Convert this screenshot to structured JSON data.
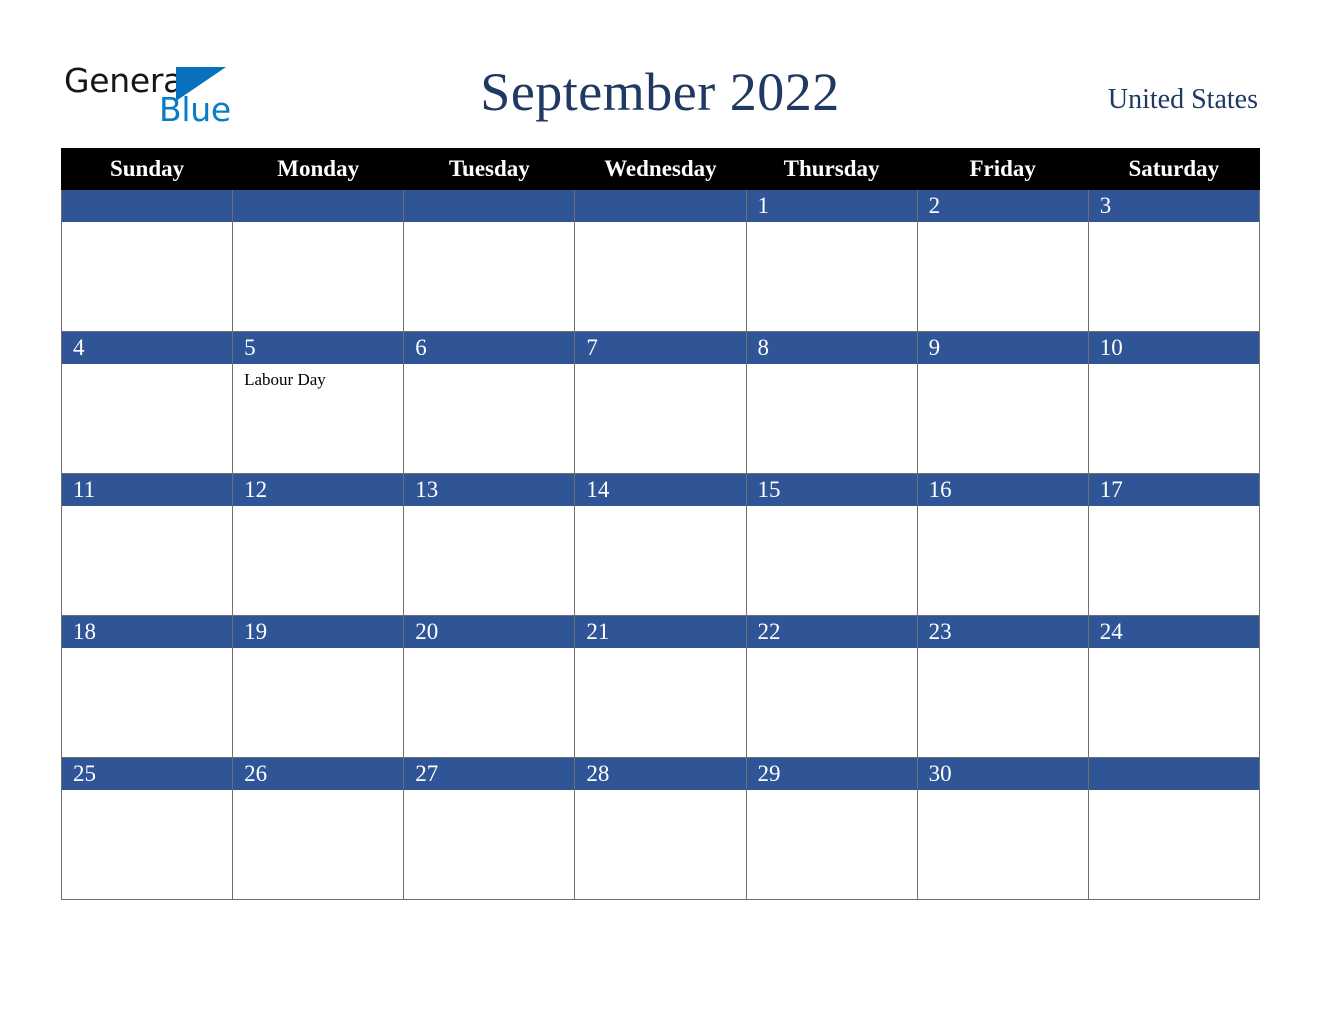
{
  "brand": {
    "logo_word_1": "General",
    "logo_word_2": "Blue",
    "triangle_icon": "triangle-icon",
    "color_black": "#14161a",
    "color_blue": "#0A7CC6"
  },
  "header": {
    "title": "September 2022",
    "locale": "United States",
    "title_color": "#1F3864"
  },
  "calendar": {
    "month": "September",
    "year": "2022",
    "accent_color": "#2F5597",
    "header_bg": "#000000",
    "weekdays": [
      "Sunday",
      "Monday",
      "Tuesday",
      "Wednesday",
      "Thursday",
      "Friday",
      "Saturday"
    ],
    "weeks": [
      [
        {
          "day": "",
          "events": []
        },
        {
          "day": "",
          "events": []
        },
        {
          "day": "",
          "events": []
        },
        {
          "day": "",
          "events": []
        },
        {
          "day": "1",
          "events": []
        },
        {
          "day": "2",
          "events": []
        },
        {
          "day": "3",
          "events": []
        }
      ],
      [
        {
          "day": "4",
          "events": []
        },
        {
          "day": "5",
          "events": [
            "Labour Day"
          ]
        },
        {
          "day": "6",
          "events": []
        },
        {
          "day": "7",
          "events": []
        },
        {
          "day": "8",
          "events": []
        },
        {
          "day": "9",
          "events": []
        },
        {
          "day": "10",
          "events": []
        }
      ],
      [
        {
          "day": "11",
          "events": []
        },
        {
          "day": "12",
          "events": []
        },
        {
          "day": "13",
          "events": []
        },
        {
          "day": "14",
          "events": []
        },
        {
          "day": "15",
          "events": []
        },
        {
          "day": "16",
          "events": []
        },
        {
          "day": "17",
          "events": []
        }
      ],
      [
        {
          "day": "18",
          "events": []
        },
        {
          "day": "19",
          "events": []
        },
        {
          "day": "20",
          "events": []
        },
        {
          "day": "21",
          "events": []
        },
        {
          "day": "22",
          "events": []
        },
        {
          "day": "23",
          "events": []
        },
        {
          "day": "24",
          "events": []
        }
      ],
      [
        {
          "day": "25",
          "events": []
        },
        {
          "day": "26",
          "events": []
        },
        {
          "day": "27",
          "events": []
        },
        {
          "day": "28",
          "events": []
        },
        {
          "day": "29",
          "events": []
        },
        {
          "day": "30",
          "events": []
        },
        {
          "day": "",
          "events": []
        }
      ]
    ]
  }
}
